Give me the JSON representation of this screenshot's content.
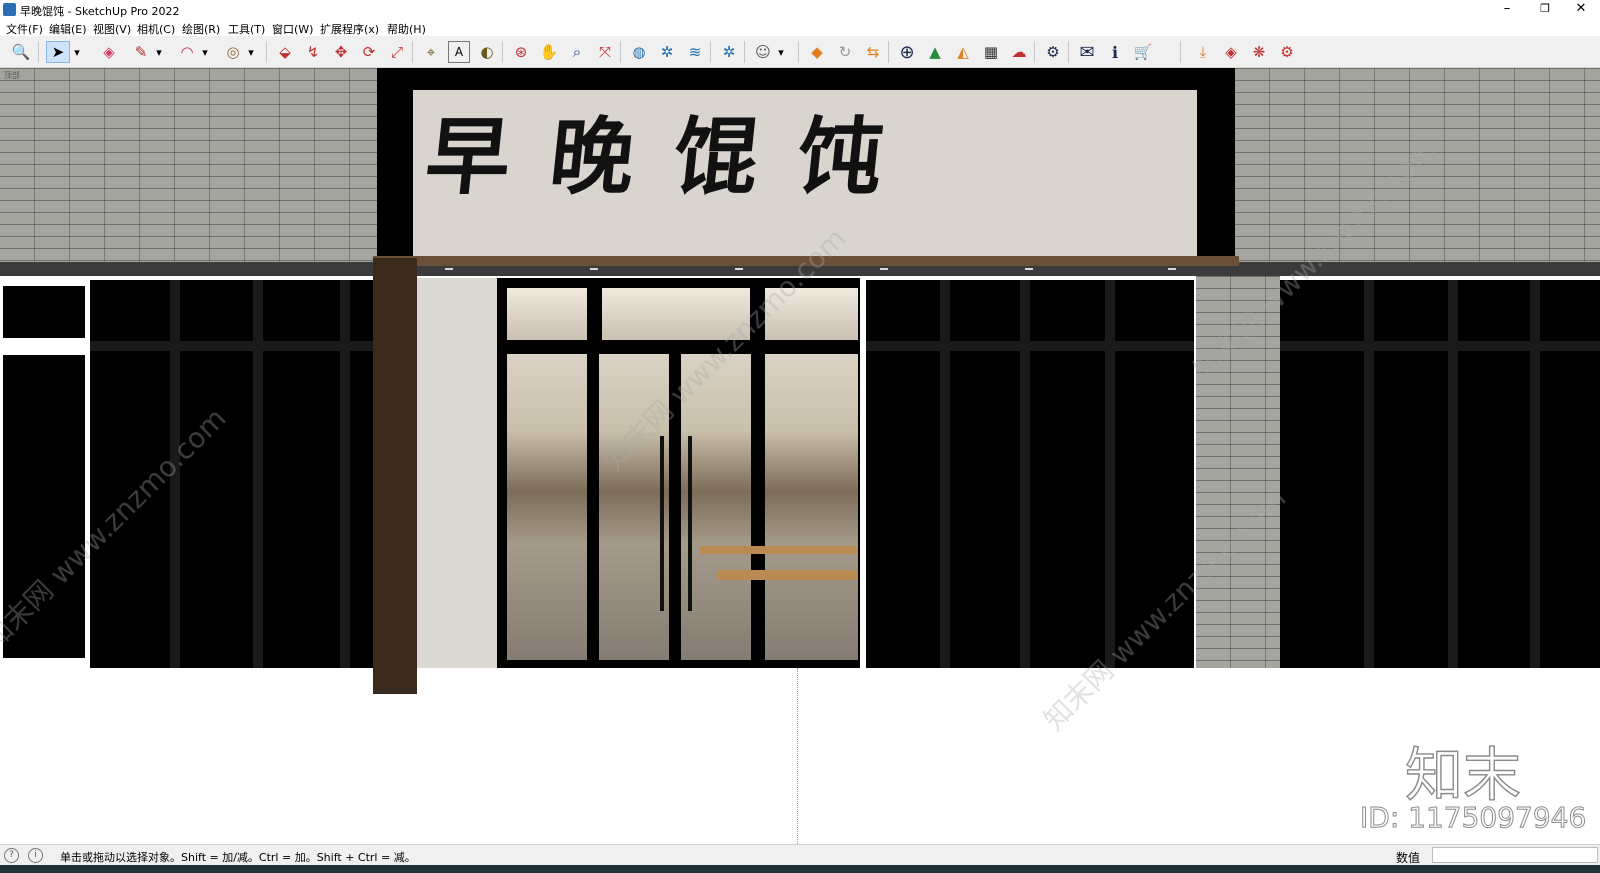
{
  "window": {
    "title": "早晚馄饨 - SketchUp Pro 2022",
    "minimize_glyph": "–",
    "restore_glyph": "❐",
    "close_glyph": "✕"
  },
  "menu": [
    "文件(F)",
    "编辑(E)",
    "视图(V)",
    "相机(C)",
    "绘图(R)",
    "工具(T)",
    "窗口(W)",
    "扩展程序(x)",
    "帮助(H)"
  ],
  "toolbar": {
    "icons": [
      {
        "name": "zoom-window-icon",
        "glyph": "🔍"
      },
      {
        "name": "select-icon",
        "glyph": "➤"
      },
      {
        "name": "select-dropdown-icon",
        "glyph": "▾"
      },
      {
        "name": "eraser-icon",
        "glyph": "◈"
      },
      {
        "name": "pencil-icon",
        "glyph": "✎"
      },
      {
        "name": "pencil-dropdown-icon",
        "glyph": "▾"
      },
      {
        "name": "arc-icon",
        "glyph": "◠"
      },
      {
        "name": "arc-dropdown-icon",
        "glyph": "▾"
      },
      {
        "name": "circle-icon",
        "glyph": "◎"
      },
      {
        "name": "circle-dropdown-icon",
        "glyph": "▾"
      },
      {
        "name": "push-pull-icon",
        "glyph": "⬙"
      },
      {
        "name": "follow-me-icon",
        "glyph": "↯"
      },
      {
        "name": "move-icon",
        "glyph": "✥"
      },
      {
        "name": "rotate-icon",
        "glyph": "⟳"
      },
      {
        "name": "scale-icon",
        "glyph": "⤢"
      },
      {
        "name": "tape-measure-icon",
        "glyph": "⌖"
      },
      {
        "name": "text-icon",
        "glyph": "A"
      },
      {
        "name": "paint-bucket-icon",
        "glyph": "◐"
      },
      {
        "name": "orbit-icon",
        "glyph": "⊛"
      },
      {
        "name": "pan-icon",
        "glyph": "✋"
      },
      {
        "name": "zoom-icon",
        "glyph": "⌕"
      },
      {
        "name": "zoom-extents-icon",
        "glyph": "⤧"
      },
      {
        "name": "warehouse-icon",
        "glyph": "◍"
      },
      {
        "name": "extension-icon",
        "glyph": "✲"
      },
      {
        "name": "layers-icon",
        "glyph": "≋"
      },
      {
        "name": "styles-icon",
        "glyph": "✲"
      },
      {
        "name": "account-icon",
        "glyph": "☺"
      },
      {
        "name": "account-dropdown-icon",
        "glyph": "▾"
      },
      {
        "name": "plugin-a-icon",
        "glyph": "◆"
      },
      {
        "name": "refresh-icon",
        "glyph": "↻"
      },
      {
        "name": "plugin-b-icon",
        "glyph": "⇆"
      },
      {
        "name": "add-icon",
        "glyph": "⊕"
      },
      {
        "name": "tree-icon",
        "glyph": "▲"
      },
      {
        "name": "terrain-icon",
        "glyph": "◭"
      },
      {
        "name": "checker-icon",
        "glyph": "▦"
      },
      {
        "name": "cloud-upload-icon",
        "glyph": "☁"
      },
      {
        "name": "settings-icon",
        "glyph": "⚙"
      },
      {
        "name": "mail-icon",
        "glyph": "✉"
      },
      {
        "name": "info-icon",
        "glyph": "ℹ"
      },
      {
        "name": "cart-icon",
        "glyph": "🛒"
      },
      {
        "name": "download-icon",
        "glyph": "⤓"
      },
      {
        "name": "plugin-c-icon",
        "glyph": "◈"
      },
      {
        "name": "plugin-d-icon",
        "glyph": "❋"
      },
      {
        "name": "plugin-e-icon",
        "glyph": "⚙"
      }
    ]
  },
  "viewport": {
    "scene_label": "顶部",
    "sign_text": "早晚馄饨",
    "watermark_text": "知末网 www.znzmo.com",
    "logo_watermark": "知末",
    "id_watermark": "ID: 1175097946"
  },
  "statusbar": {
    "message": "单击或拖动以选择对象。Shift = 加/减。Ctrl = 加。Shift + Ctrl = 减。",
    "value_label": "数值",
    "value": ""
  },
  "colors": {
    "toolbar_bg": "#f0f0f0",
    "selected_tool": "#cde3fb",
    "brick": "#a4a59f",
    "canopy": "#6b4e36",
    "sign_board": "#d9d5ce"
  }
}
